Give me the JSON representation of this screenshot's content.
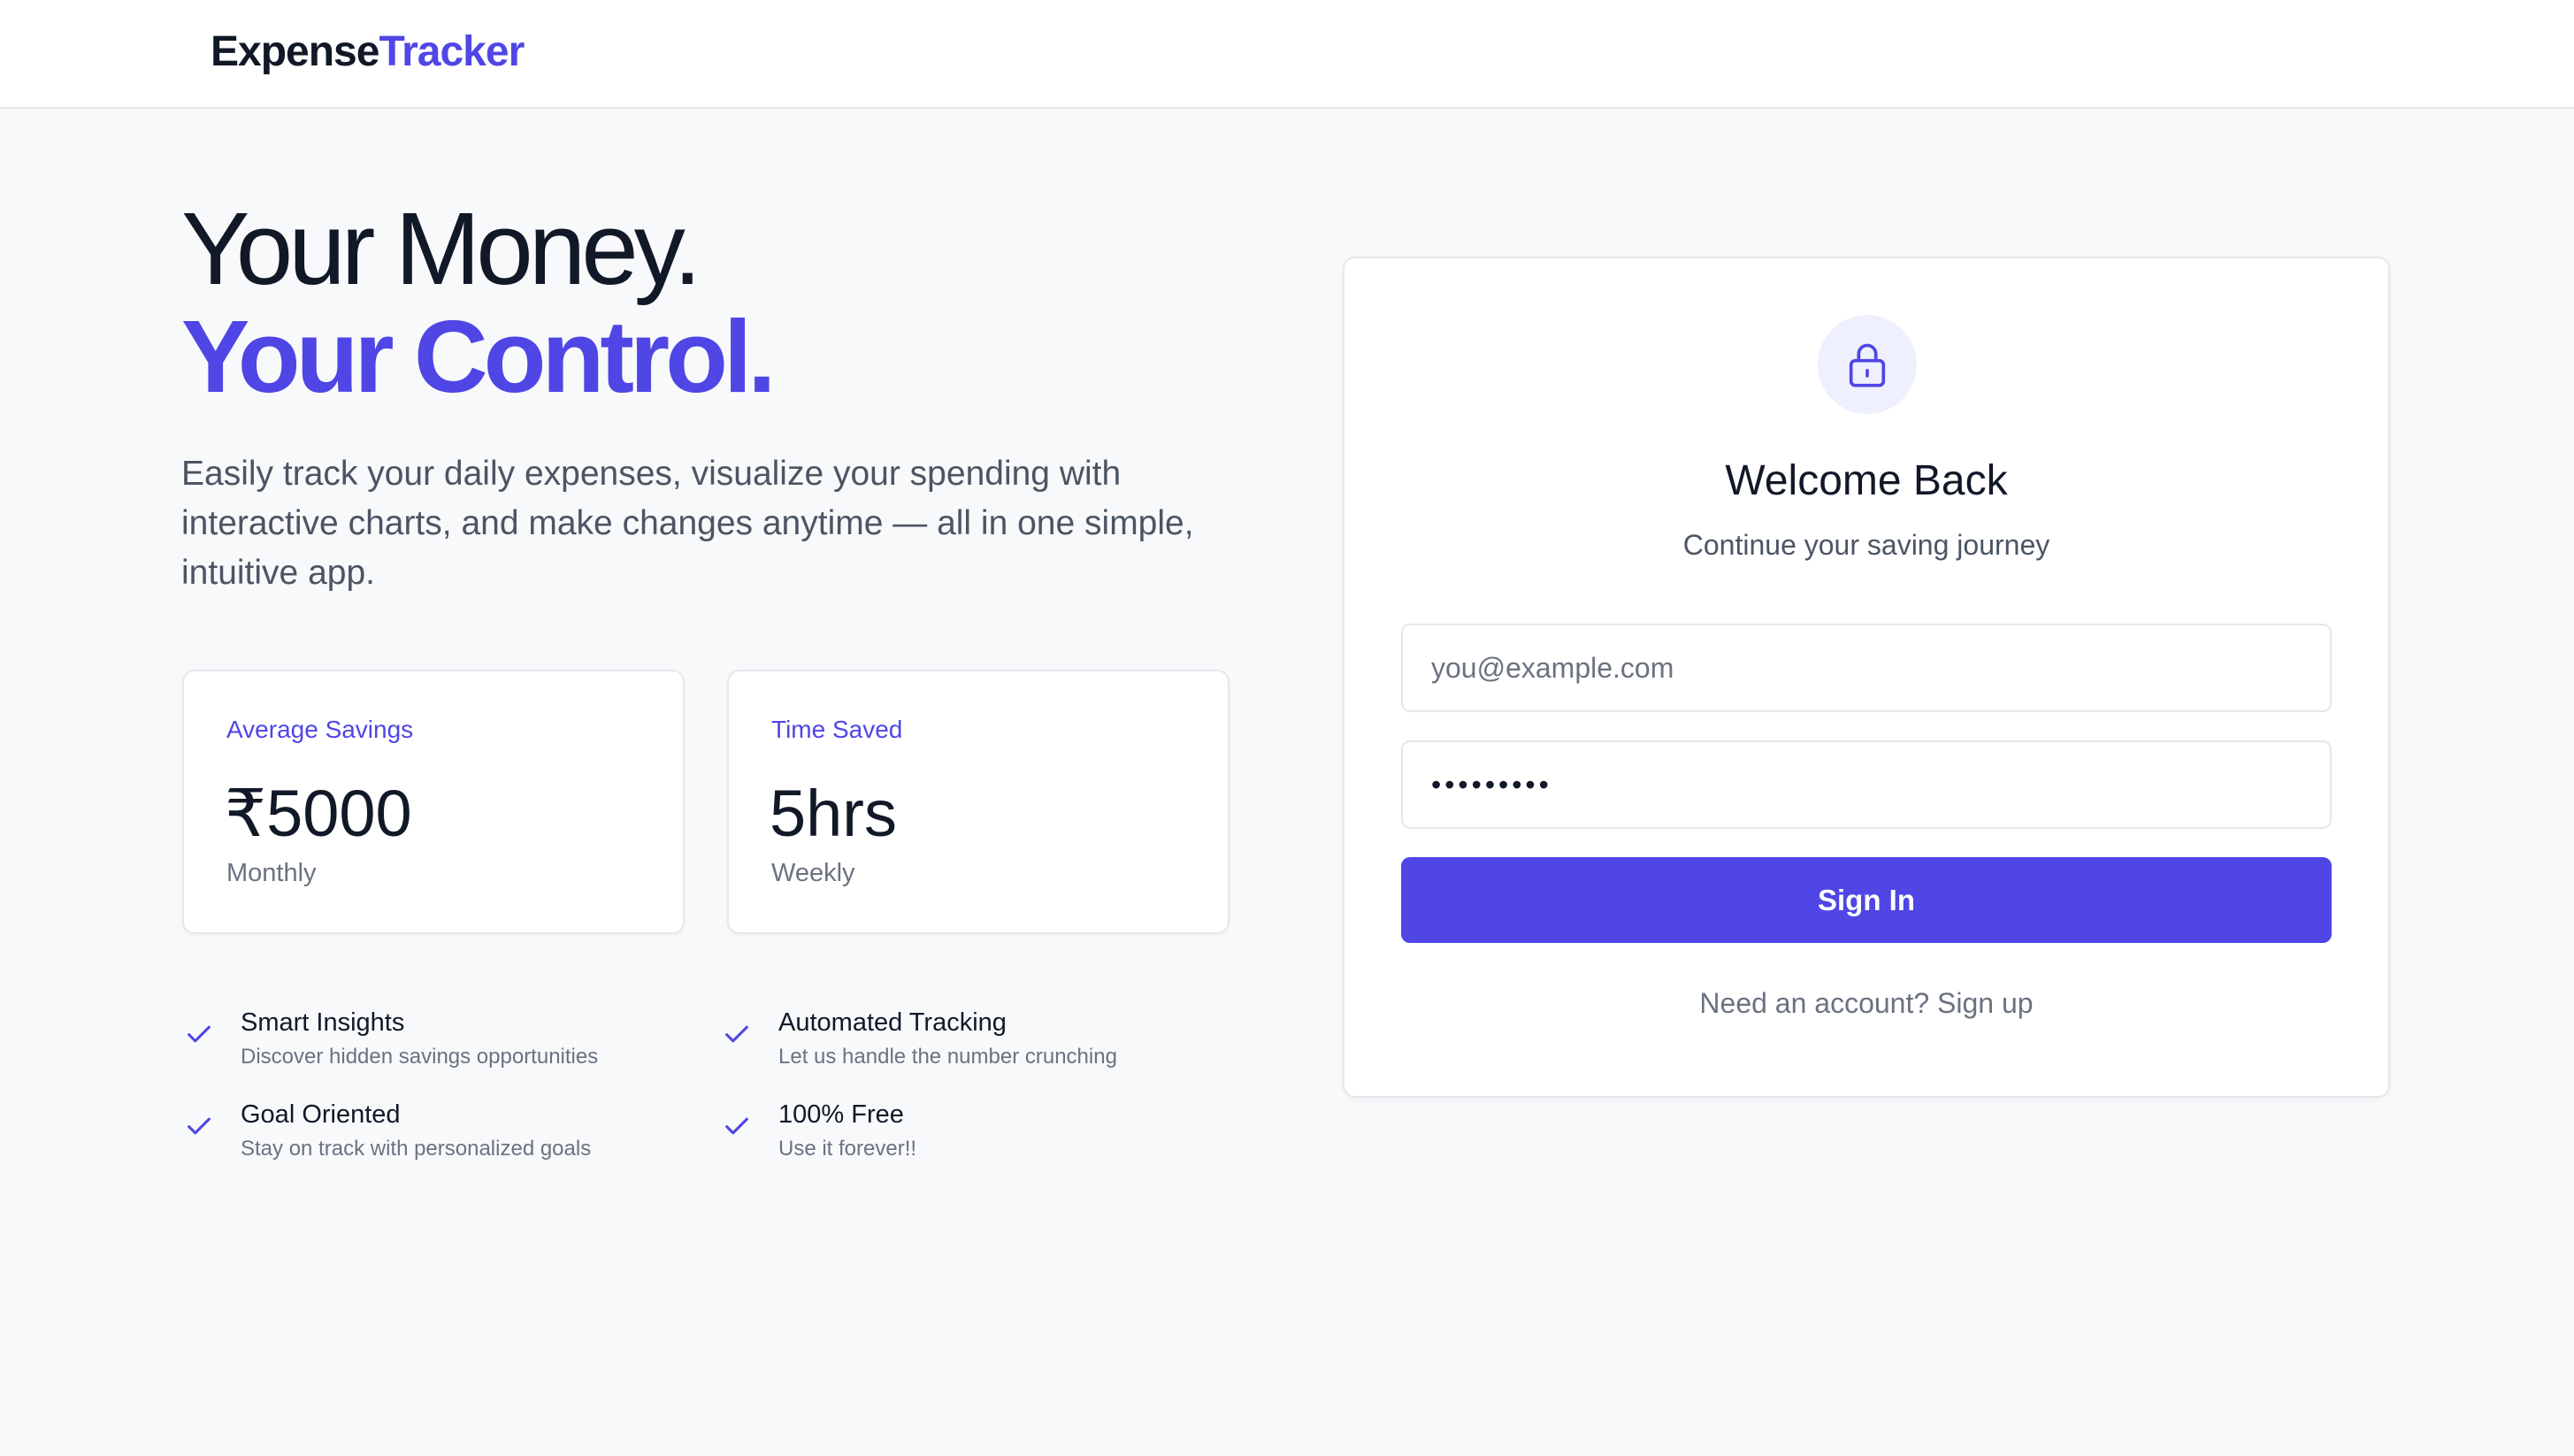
{
  "app": {
    "logo_part1": "Expense",
    "logo_part2": "Tracker",
    "brand_color": "#4f46e5"
  },
  "hero": {
    "headline_line1": "Your Money.",
    "headline_line2": "Your Control.",
    "description": "Easily track your daily expenses, visualize your spending with interactive charts, and make changes anytime — all in one simple, intuitive app."
  },
  "stats": [
    {
      "label": "Average Savings",
      "value": "₹5000",
      "period": "Monthly"
    },
    {
      "label": "Time Saved",
      "value": "5hrs",
      "period": "Weekly"
    }
  ],
  "features": [
    {
      "title": "Smart Insights",
      "description": "Discover hidden savings opportunities",
      "icon": "check-icon"
    },
    {
      "title": "Automated Tracking",
      "description": "Let us handle the number crunching",
      "icon": "check-icon"
    },
    {
      "title": "Goal Oriented",
      "description": "Stay on track with personalized goals",
      "icon": "check-icon"
    },
    {
      "title": "100% Free",
      "description": "Use it forever!!",
      "icon": "check-icon"
    }
  ],
  "login": {
    "icon": "lock-icon",
    "title": "Welcome Back",
    "subtitle": "Continue your saving journey",
    "email_placeholder": "you@example.com",
    "email_value": "",
    "password_value": "•••••••••",
    "signin_label": "Sign In",
    "signup_text": "Need an account? Sign up"
  }
}
